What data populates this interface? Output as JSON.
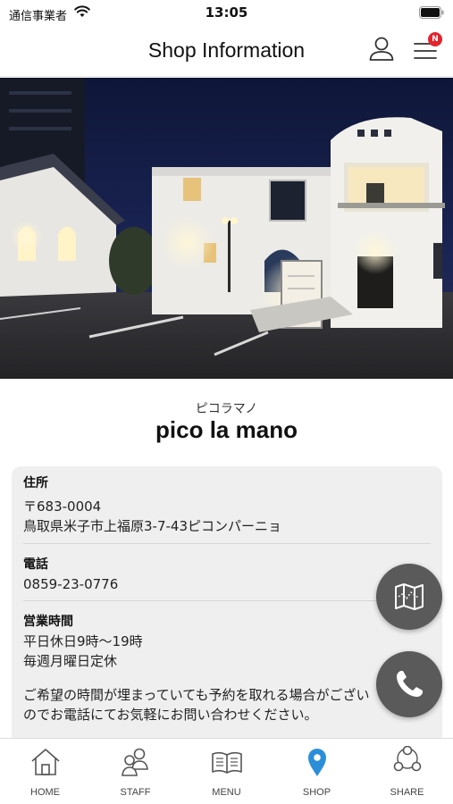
{
  "status_bar": {
    "carrier": "通信事業者",
    "time": "13:05"
  },
  "header": {
    "title": "Shop Information",
    "badge": "N"
  },
  "shop": {
    "kana": "ピコラマノ",
    "name": "pico la mano"
  },
  "info": {
    "address_label": "住所",
    "postal_code": "〒683-0004",
    "address": "鳥取県米子市上福原3-7-43ピコンパーニョ",
    "phone_label": "電話",
    "phone": "0859-23-0776",
    "hours_label": "営業時間",
    "hours_line1": "平日休日9時〜19時",
    "hours_line2": "毎週月曜日定休",
    "note_line1": "ご希望の時間が埋まっていても予約を取れる場合がござい",
    "note_line2": "のでお電話にてお気軽にお問い合わせください。"
  },
  "tabs": [
    {
      "label": "HOME",
      "icon": "home-icon"
    },
    {
      "label": "STAFF",
      "icon": "staff-icon"
    },
    {
      "label": "MENU",
      "icon": "book-icon"
    },
    {
      "label": "SHOP",
      "icon": "map-pin-icon"
    },
    {
      "label": "SHARE",
      "icon": "share-icon"
    }
  ],
  "colors": {
    "accent": "#2a8fd8",
    "fab": "#5a5a5a",
    "badge": "#e0252e"
  }
}
